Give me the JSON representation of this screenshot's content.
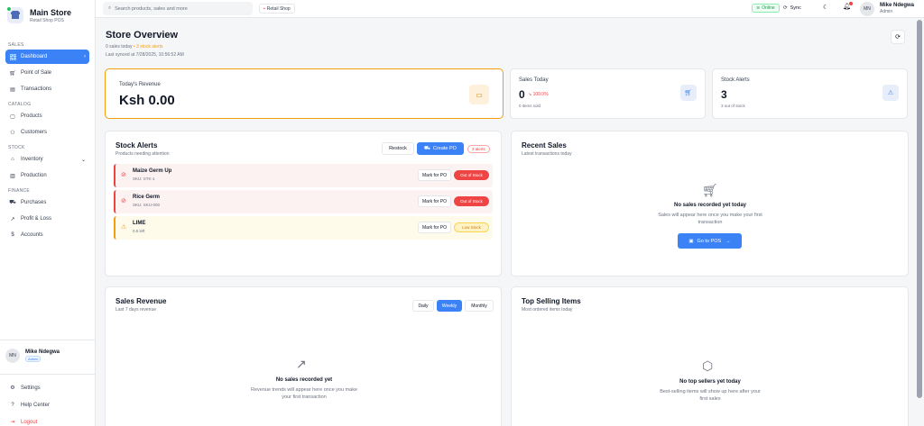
{
  "brand": {
    "title": "Main Store",
    "subtitle": "Retail Shop POS"
  },
  "sidebar": {
    "sections": [
      {
        "label": "SALES"
      },
      {
        "label": "CATALOG"
      },
      {
        "label": "STOCK"
      },
      {
        "label": "FINANCE"
      }
    ],
    "items": [
      {
        "label": "Dashboard",
        "icon": "grid-icon",
        "active": true
      },
      {
        "label": "Point of Sale",
        "icon": "cart-icon"
      },
      {
        "label": "Transactions",
        "icon": "receipt-icon"
      },
      {
        "label": "Products",
        "icon": "box-icon"
      },
      {
        "label": "Customers",
        "icon": "users-icon"
      },
      {
        "label": "Inventory",
        "icon": "warehouse-icon"
      },
      {
        "label": "Production",
        "icon": "factory-icon"
      },
      {
        "label": "Purchases",
        "icon": "truck-icon"
      },
      {
        "label": "Profit & Loss",
        "icon": "trend-icon"
      },
      {
        "label": "Accounts",
        "icon": "dollar-icon"
      }
    ],
    "user": {
      "initials": "MN",
      "name": "Mike Ndegwa",
      "role": "Admin"
    },
    "bottom": {
      "settings": "Settings",
      "help": "Help Center",
      "logout": "Logout"
    }
  },
  "topbar": {
    "search_placeholder": "Search products, sales and more",
    "shop": "Retail Shop",
    "status": "Online",
    "sync": "Sync",
    "user_initials": "MN",
    "user_name": "Mike Ndegwa",
    "user_role": "Admin"
  },
  "page": {
    "title": "Store Overview",
    "sales_today_text": "0 sales today",
    "stock_alerts_text": "• 3 stock alerts",
    "last_synced": "Last synced at 7/28/2025, 10:56:52 AM"
  },
  "revenue": {
    "label": "Today's Revenue",
    "value": "Ksh 0.00"
  },
  "sales_today": {
    "label": "Sales Today",
    "value": "0",
    "delta": "↘ 100.0%",
    "foot": "0 items sold"
  },
  "stock_alerts_stat": {
    "label": "Stock Alerts",
    "value": "3",
    "foot": "3 out of stock"
  },
  "stock_alerts": {
    "title": "Stock Alerts",
    "subtitle": "Products needing attention",
    "restock": "Restock",
    "create_po": "Create PO",
    "count": "3 alerts",
    "items": [
      {
        "name": "Maize Germ Up",
        "sku": "SKU: STK-1",
        "action": "Mark for PO",
        "status": "Out of Stock"
      },
      {
        "name": "Rice Germ",
        "sku": "SKU: SKU-000",
        "action": "Mark for PO",
        "status": "Out of Stock"
      },
      {
        "name": "LIME",
        "sku": "0.5 left",
        "action": "Mark for PO",
        "status": "Low Stock"
      }
    ]
  },
  "recent_sales": {
    "title": "Recent Sales",
    "subtitle": "Latest transactions today",
    "empty_title": "No sales recorded yet today",
    "empty_text_1": "Sales will appear here once you make your first",
    "empty_text_2": "transaction",
    "button": "Go to POS"
  },
  "sales_revenue": {
    "title": "Sales Revenue",
    "subtitle": "Last 7 days revenue",
    "tabs": [
      "Daily",
      "Weekly",
      "Monthly"
    ],
    "active_tab": "Weekly",
    "empty_title": "No sales recorded yet",
    "empty_text_1": "Revenue trends will appear here once you make",
    "empty_text_2": "your first transaction"
  },
  "top_selling": {
    "title": "Top Selling Items",
    "subtitle": "Most ordered items today",
    "empty_title": "No top sellers yet today",
    "empty_text_1": "Best-selling items will show up here after your",
    "empty_text_2": "first sales"
  },
  "colors": {
    "accent": "#3b82f6",
    "danger": "#ef4444",
    "warning": "#f59e0b",
    "success": "#22c55e"
  }
}
